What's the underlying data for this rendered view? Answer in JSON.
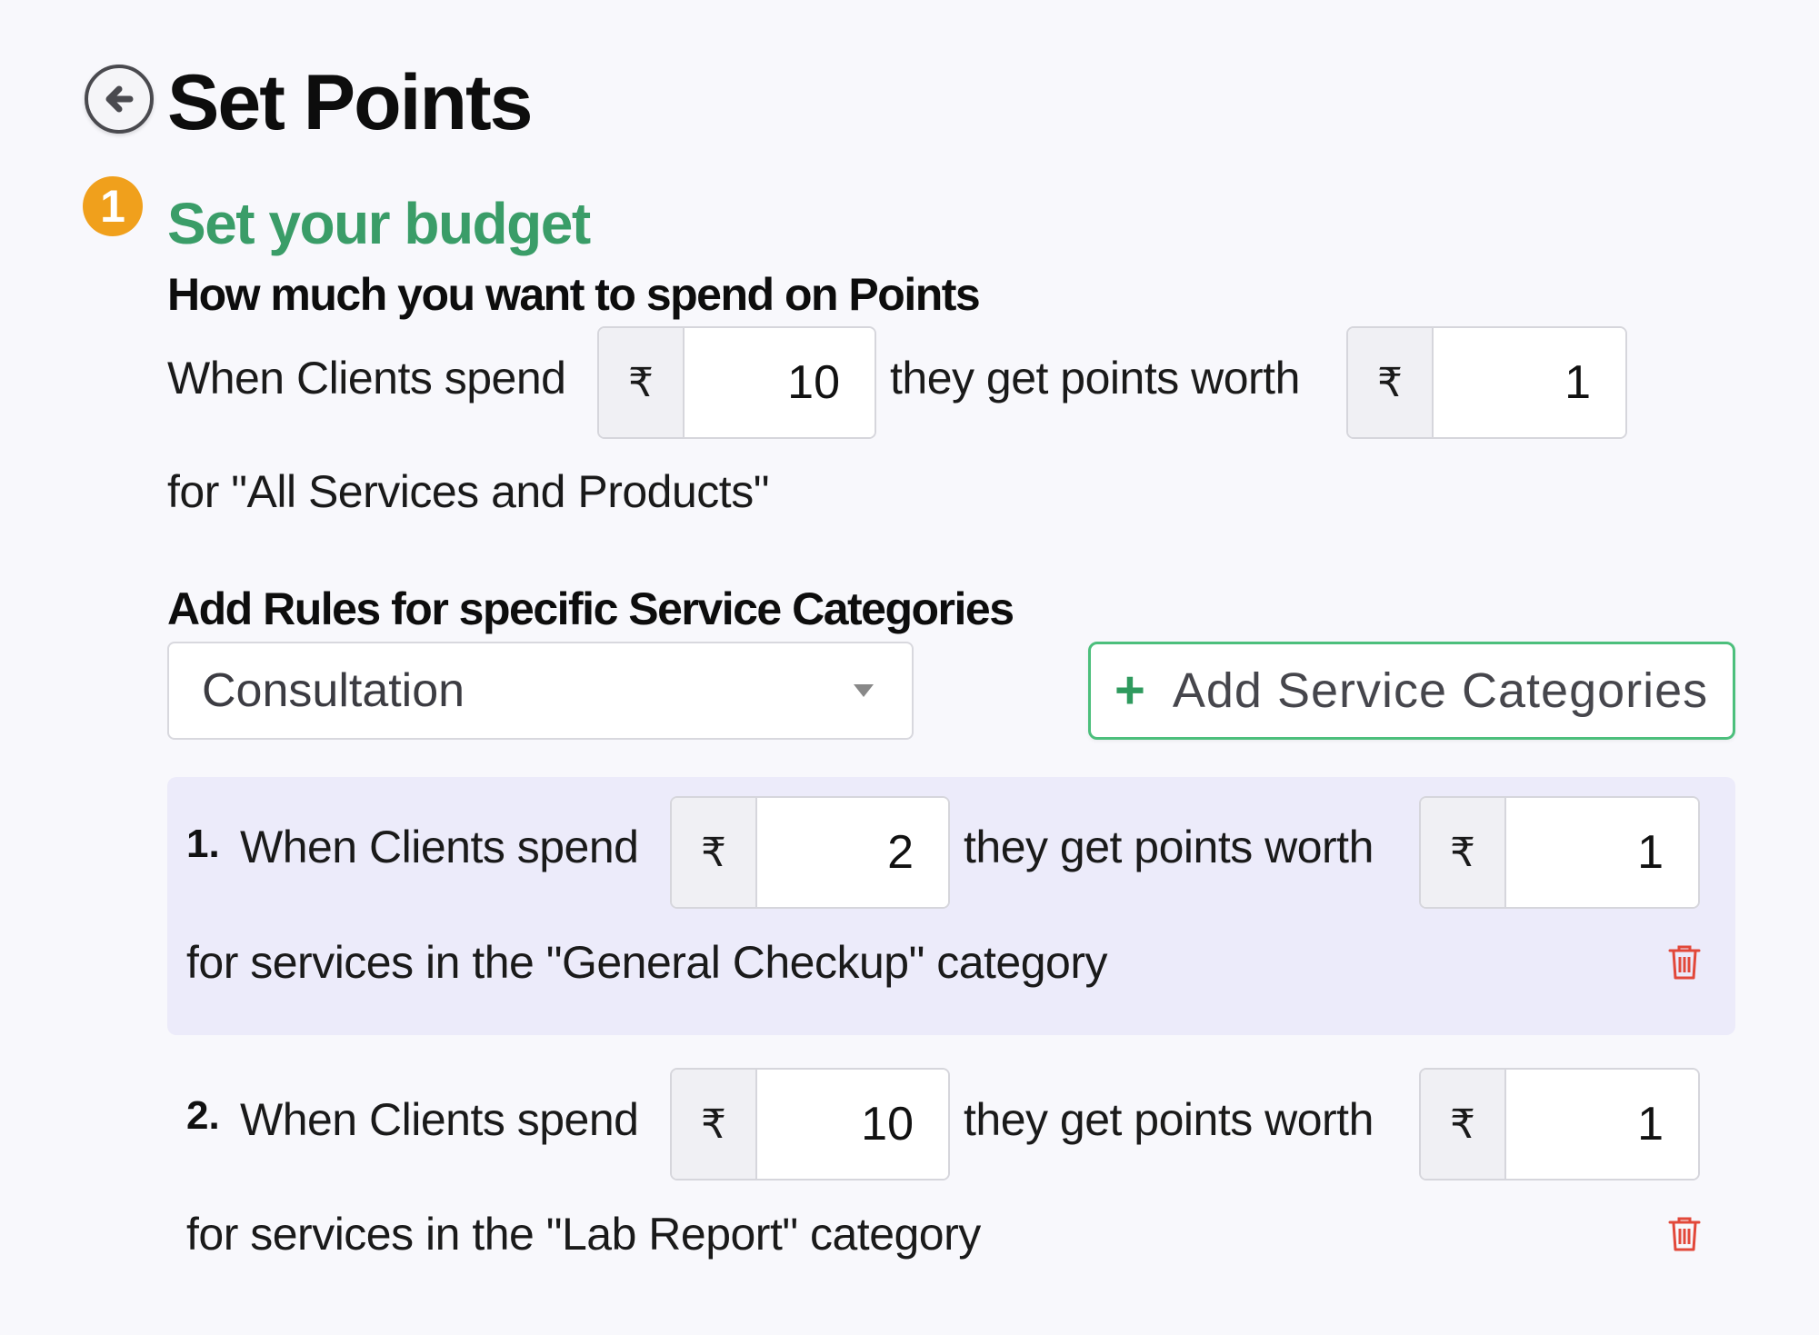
{
  "header": {
    "back_icon": "arrow-left-circle-icon",
    "title": "Set Points"
  },
  "step": {
    "number": "1",
    "title": "Set your budget",
    "subheading": "How much you want to spend on Points"
  },
  "base_rule": {
    "spend_label": "When Clients spend",
    "currency_symbol": "₹",
    "spend_value": "10",
    "worth_label": "they get points worth",
    "worth_value": "1",
    "scope_text": "for \"All Services and Products\""
  },
  "category_rules": {
    "heading": "Add Rules for specific Service Categories",
    "select": {
      "selected": "Consultation"
    },
    "add_button": {
      "icon": "plus-icon",
      "label": "Add Service Categories"
    },
    "rules": [
      {
        "number": "1.",
        "spend_label": "When Clients spend",
        "currency_symbol": "₹",
        "spend_value": "2",
        "worth_label": "they get points worth",
        "worth_value": "1",
        "scope_text": "for services in the \"General Checkup\" category",
        "delete_icon": "trash-icon"
      },
      {
        "number": "2.",
        "spend_label": "When Clients spend",
        "currency_symbol": "₹",
        "spend_value": "10",
        "worth_label": "they get points worth",
        "worth_value": "1",
        "scope_text": "for services in the \"Lab Report\" category",
        "delete_icon": "trash-icon"
      }
    ]
  },
  "colors": {
    "accent_green": "#3a9d68",
    "badge_orange": "#f0a01c",
    "delete_red": "#e2483a",
    "card_highlight": "#ecebfa"
  }
}
